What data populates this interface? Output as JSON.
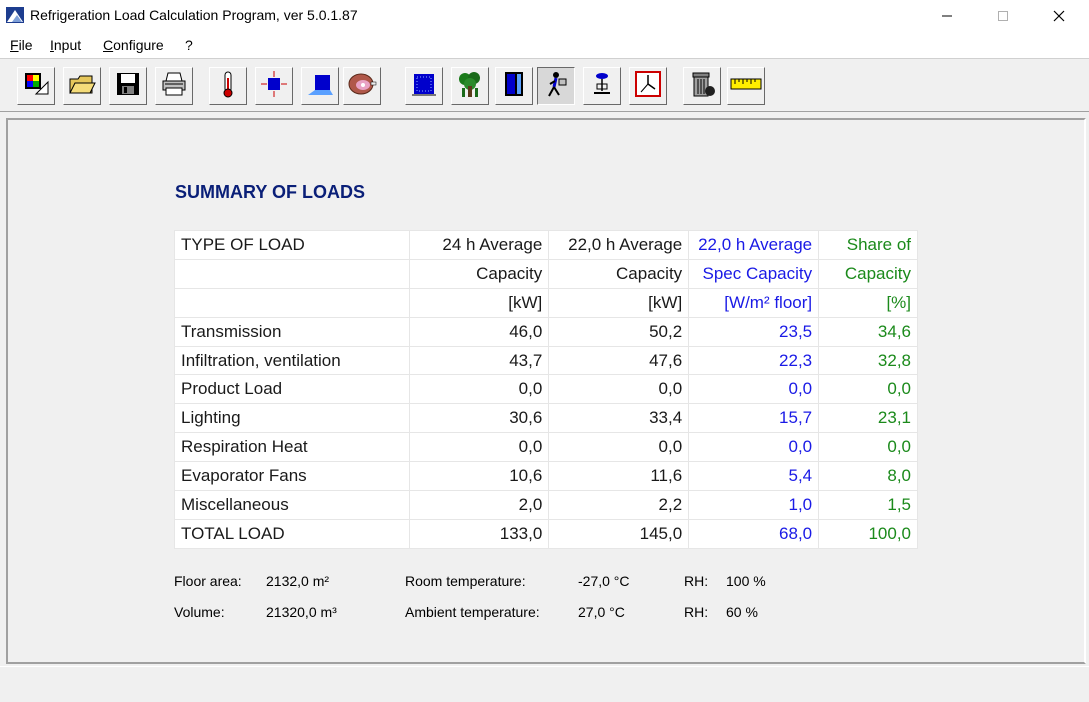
{
  "window": {
    "title": "Refrigeration Load Calculation Program, ver 5.0.1.87"
  },
  "menu": [
    {
      "label": "File"
    },
    {
      "label": "Input"
    },
    {
      "label": "Configure"
    },
    {
      "label": "?"
    }
  ],
  "toolbar": {
    "icons": [
      "new-icon",
      "open-folder-icon",
      "save-icon",
      "print-icon",
      "thermometer-icon",
      "room-dimensions-icon",
      "floor-icon",
      "product-meat-icon",
      "insulation-icon",
      "plant-respiration-icon",
      "door-icon",
      "people-icon",
      "lighting-icon",
      "clock-icon",
      "trash-can-icon",
      "ruler-icon"
    ],
    "pressed": "people-icon"
  },
  "summary": {
    "title": "SUMMARY OF LOADS",
    "header": [
      [
        "TYPE OF LOAD",
        "24 h Average",
        "22,0 h Average",
        "22,0 h Average",
        "Share of"
      ],
      [
        "",
        "Capacity",
        "Capacity",
        "Spec Capacity",
        "Capacity"
      ],
      [
        "",
        "[kW]",
        "[kW]",
        "[W/m² floor]",
        "[%]"
      ]
    ],
    "rows": [
      [
        "Transmission",
        "46,0",
        "50,2",
        "23,5",
        "34,6"
      ],
      [
        "Infiltration, ventilation",
        "43,7",
        "47,6",
        "22,3",
        "32,8"
      ],
      [
        "Product Load",
        "0,0",
        "0,0",
        "0,0",
        "0,0"
      ],
      [
        "Lighting",
        "30,6",
        "33,4",
        "15,7",
        "23,1"
      ],
      [
        "Respiration Heat",
        "0,0",
        "0,0",
        "0,0",
        "0,0"
      ],
      [
        "Evaporator Fans",
        "10,6",
        "11,6",
        "5,4",
        "8,0"
      ],
      [
        "Miscellaneous",
        "2,0",
        "2,2",
        "1,0",
        "1,5"
      ],
      [
        "TOTAL LOAD",
        "133,0",
        "145,0",
        "68,0",
        "100,0"
      ]
    ]
  },
  "info": {
    "floor_label": "Floor area:",
    "floor_value": "2132,0 m²",
    "volume_label": "Volume:",
    "volume_value": "21320,0 m³",
    "room_temp_label": "Room temperature:",
    "room_temp_value": "-27,0 °C",
    "ambient_temp_label": "Ambient temperature:",
    "ambient_temp_value": "27,0 °C",
    "rh_label": "RH:",
    "rh_room_value": "100 %",
    "rh_ambient_value": "60 %"
  },
  "colors": {
    "title": "#0a1f78",
    "spec_capacity": "#1a1ae6",
    "share": "#1b8a1b"
  }
}
